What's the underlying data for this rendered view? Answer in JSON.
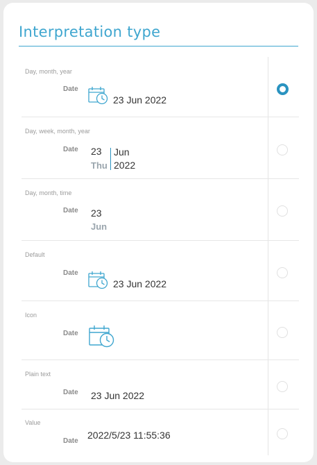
{
  "title": "Interpretation type",
  "date_label": "Date",
  "options": [
    {
      "label": "Day, month, year",
      "value": "23 Jun 2022",
      "selected": true
    },
    {
      "label": "Day, week, month, year",
      "day": "23",
      "weekday": "Thu",
      "month": "Jun",
      "year": "2022",
      "selected": false
    },
    {
      "label": "Day, month, time",
      "day": "23",
      "month": "Jun",
      "selected": false
    },
    {
      "label": "Default",
      "value": "23 Jun 2022",
      "selected": false
    },
    {
      "label": "Icon",
      "selected": false
    },
    {
      "label": "Plain text",
      "value": "23 Jun 2022",
      "selected": false
    },
    {
      "label": "Value",
      "value": "2022/5/23 11:55:36",
      "selected": false
    }
  ],
  "colors": {
    "accent": "#2a93c0",
    "title": "#3fa6cf"
  },
  "icons": {
    "calendar": "calendar-clock-icon"
  }
}
